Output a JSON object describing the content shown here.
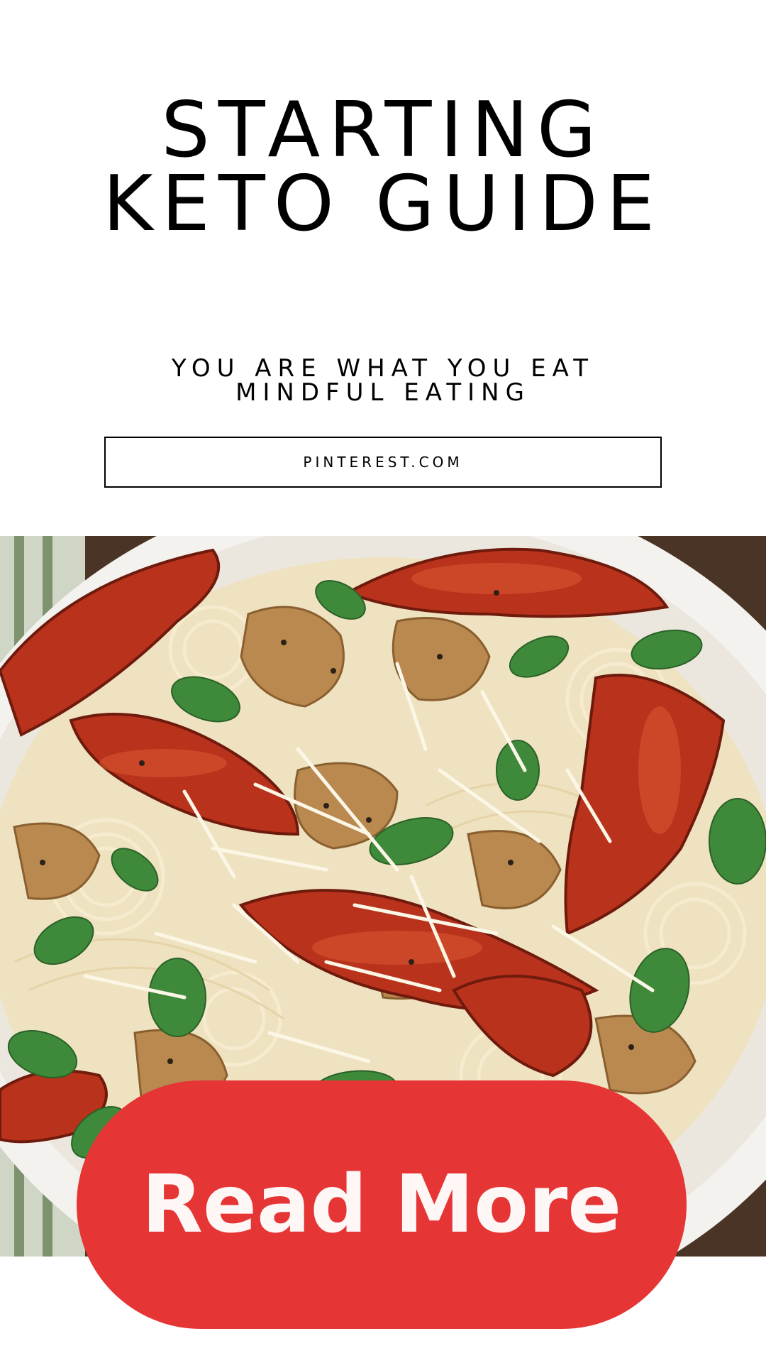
{
  "title": {
    "line1": "STARTING",
    "line2": "KETO GUIDE"
  },
  "subtitle": {
    "line1": "YOU ARE WHAT YOU EAT",
    "line2": "MINDFUL EATING"
  },
  "link": {
    "label": "PINTEREST.COM"
  },
  "cta": {
    "label": "Read More",
    "color": "#e53535"
  }
}
